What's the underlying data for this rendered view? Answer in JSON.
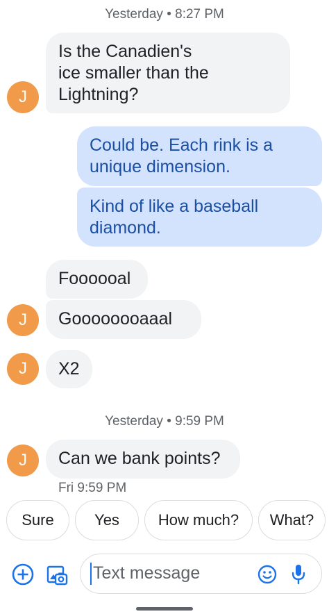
{
  "timestamps": {
    "first": "Yesterday • 8:27 PM",
    "second": "Yesterday • 9:59 PM",
    "last_msg_time": "Fri 9:59 PM"
  },
  "avatar_letter": "J",
  "messages": [
    {
      "text_lines": [
        "Is the Canadien's",
        "ice smaller than the",
        "Lightning?"
      ],
      "from": "contact"
    },
    {
      "text_lines": [
        "Could be. Each rink is a",
        "unique dimension."
      ],
      "from": "me"
    },
    {
      "text_lines": [
        "Kind of like a baseball",
        "diamond."
      ],
      "from": "me"
    },
    {
      "text": "Foooooal",
      "from": "contact"
    },
    {
      "text": "Goooooooaaal",
      "from": "contact"
    },
    {
      "text": "X2",
      "from": "contact"
    },
    {
      "text": "Can we bank points?",
      "from": "contact"
    }
  ],
  "smart_replies": [
    "Sure",
    "Yes",
    "How much?",
    "What?"
  ],
  "composer": {
    "placeholder": "Text message",
    "icons": [
      "add-icon",
      "gallery-camera-icon",
      "emoji-icon",
      "mic-icon"
    ]
  },
  "colors": {
    "incoming_bubble": "#f1f3f4",
    "outgoing_bubble": "#d3e3fd",
    "outgoing_text": "#1a4fa3",
    "avatar": "#f09a4a",
    "accent": "#1a73e8"
  }
}
